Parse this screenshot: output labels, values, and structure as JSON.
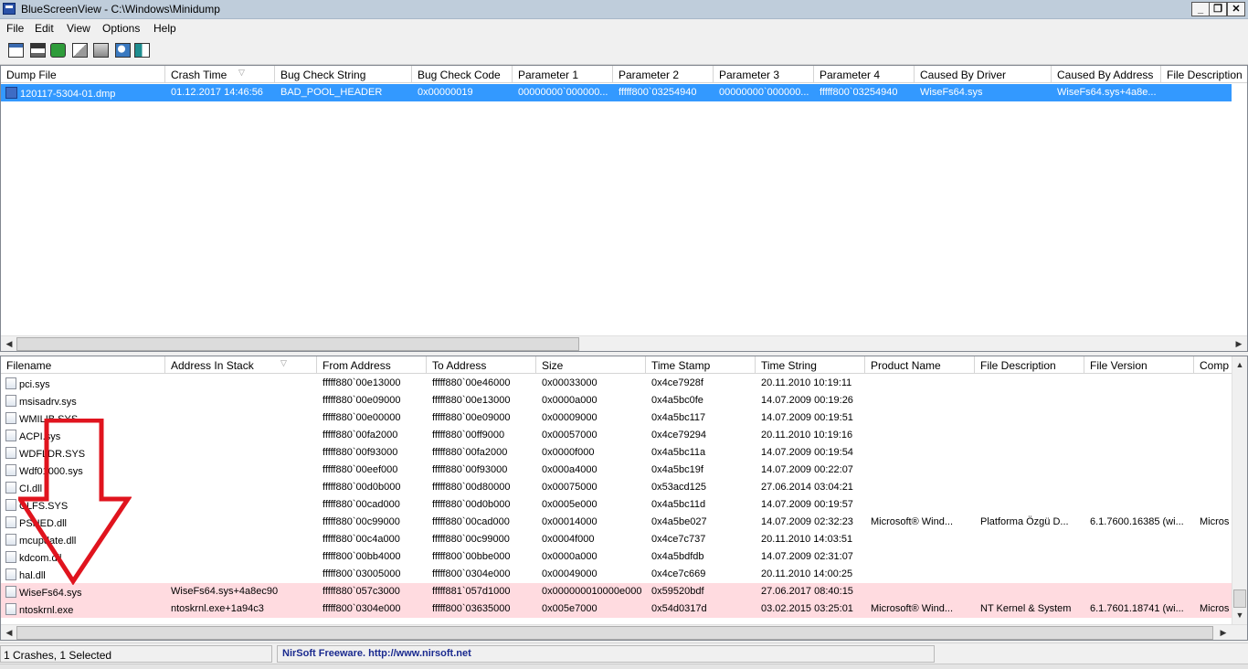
{
  "window": {
    "title": "BlueScreenView  -  C:\\Windows\\Minidump",
    "controls": {
      "minimize": "_",
      "maximize": "❐",
      "close": "✕"
    },
    "icon": "bluescreenview-app-icon"
  },
  "menu": [
    "File",
    "Edit",
    "View",
    "Options",
    "Help"
  ],
  "toolbar": {
    "icons": [
      "properties-icon",
      "save-icon",
      "refresh-icon",
      "copy-icon",
      "options-icon",
      "find-icon",
      "exit-icon"
    ]
  },
  "dumps": {
    "columns": [
      "Dump File",
      "Crash Time",
      "Bug Check String",
      "Bug Check Code",
      "Parameter 1",
      "Parameter 2",
      "Parameter 3",
      "Parameter 4",
      "Caused By Driver",
      "Caused By Address",
      "File Description"
    ],
    "sort_column": 1,
    "rows": [
      [
        "120117-5304-01.dmp",
        "01.12.2017 14:46:56",
        "BAD_POOL_HEADER",
        "0x00000019",
        "00000000`000000...",
        "fffff800`03254940",
        "00000000`000000...",
        "fffff800`03254940",
        "WiseFs64.sys",
        "WiseFs64.sys+4a8e...",
        ""
      ]
    ],
    "selected_row": 0
  },
  "drivers": {
    "columns": [
      "Filename",
      "Address In Stack",
      "From Address",
      "To Address",
      "Size",
      "Time Stamp",
      "Time String",
      "Product Name",
      "File Description",
      "File Version",
      "Comp"
    ],
    "sort_column": 1,
    "rows": [
      [
        "pci.sys",
        "",
        "fffff880`00e13000",
        "fffff880`00e46000",
        "0x00033000",
        "0x4ce7928f",
        "20.11.2010 10:19:11",
        "",
        "",
        "",
        ""
      ],
      [
        "msisadrv.sys",
        "",
        "fffff880`00e09000",
        "fffff880`00e13000",
        "0x0000a000",
        "0x4a5bc0fe",
        "14.07.2009 00:19:26",
        "",
        "",
        "",
        ""
      ],
      [
        "WMILIB.SYS",
        "",
        "fffff880`00e00000",
        "fffff880`00e09000",
        "0x00009000",
        "0x4a5bc117",
        "14.07.2009 00:19:51",
        "",
        "",
        "",
        ""
      ],
      [
        "ACPI.sys",
        "",
        "fffff880`00fa2000",
        "fffff880`00ff9000",
        "0x00057000",
        "0x4ce79294",
        "20.11.2010 10:19:16",
        "",
        "",
        "",
        ""
      ],
      [
        "WDFLDR.SYS",
        "",
        "fffff880`00f93000",
        "fffff880`00fa2000",
        "0x0000f000",
        "0x4a5bc11a",
        "14.07.2009 00:19:54",
        "",
        "",
        "",
        ""
      ],
      [
        "Wdf01000.sys",
        "",
        "fffff880`00eef000",
        "fffff880`00f93000",
        "0x000a4000",
        "0x4a5bc19f",
        "14.07.2009 00:22:07",
        "",
        "",
        "",
        ""
      ],
      [
        "CI.dll",
        "",
        "fffff880`00d0b000",
        "fffff880`00d80000",
        "0x00075000",
        "0x53acd125",
        "27.06.2014 03:04:21",
        "",
        "",
        "",
        ""
      ],
      [
        "CLFS.SYS",
        "",
        "fffff880`00cad000",
        "fffff880`00d0b000",
        "0x0005e000",
        "0x4a5bc11d",
        "14.07.2009 00:19:57",
        "",
        "",
        "",
        ""
      ],
      [
        "PSHED.dll",
        "",
        "fffff880`00c99000",
        "fffff880`00cad000",
        "0x00014000",
        "0x4a5be027",
        "14.07.2009 02:32:23",
        "Microsoft® Wind...",
        "Platforma Özgü D...",
        "6.1.7600.16385 (wi...",
        "Micros"
      ],
      [
        "mcupdate.dll",
        "",
        "fffff880`00c4a000",
        "fffff880`00c99000",
        "0x0004f000",
        "0x4ce7c737",
        "20.11.2010 14:03:51",
        "",
        "",
        "",
        ""
      ],
      [
        "kdcom.dll",
        "",
        "fffff800`00bb4000",
        "fffff800`00bbe000",
        "0x0000a000",
        "0x4a5bdfdb",
        "14.07.2009 02:31:07",
        "",
        "",
        "",
        ""
      ],
      [
        "hal.dll",
        "",
        "fffff800`03005000",
        "fffff800`0304e000",
        "0x00049000",
        "0x4ce7c669",
        "20.11.2010 14:00:25",
        "",
        "",
        "",
        ""
      ],
      [
        "WiseFs64.sys",
        "WiseFs64.sys+4a8ec90",
        "fffff880`057c3000",
        "fffff881`057d1000",
        "0x000000010000e000",
        "0x59520bdf",
        "27.06.2017 08:40:15",
        "",
        "",
        "",
        ""
      ],
      [
        "ntoskrnl.exe",
        "ntoskrnl.exe+1a94c3",
        "fffff800`0304e000",
        "fffff800`03635000",
        "0x005e7000",
        "0x54d0317d",
        "03.02.2015 03:25:01",
        "Microsoft® Wind...",
        "NT Kernel & System",
        "6.1.7601.18741 (wi...",
        "Micros"
      ]
    ],
    "highlighted_rows": [
      12,
      13
    ]
  },
  "status": {
    "crashes": "1 Crashes, 1 Selected",
    "nirsoft": "NirSoft Freeware.  http://www.nirsoft.net"
  },
  "colors": {
    "selection": "#3399ff",
    "highlight": "#ffdbe0",
    "arrow": "#e0141e",
    "link": "#1a2a8f"
  }
}
